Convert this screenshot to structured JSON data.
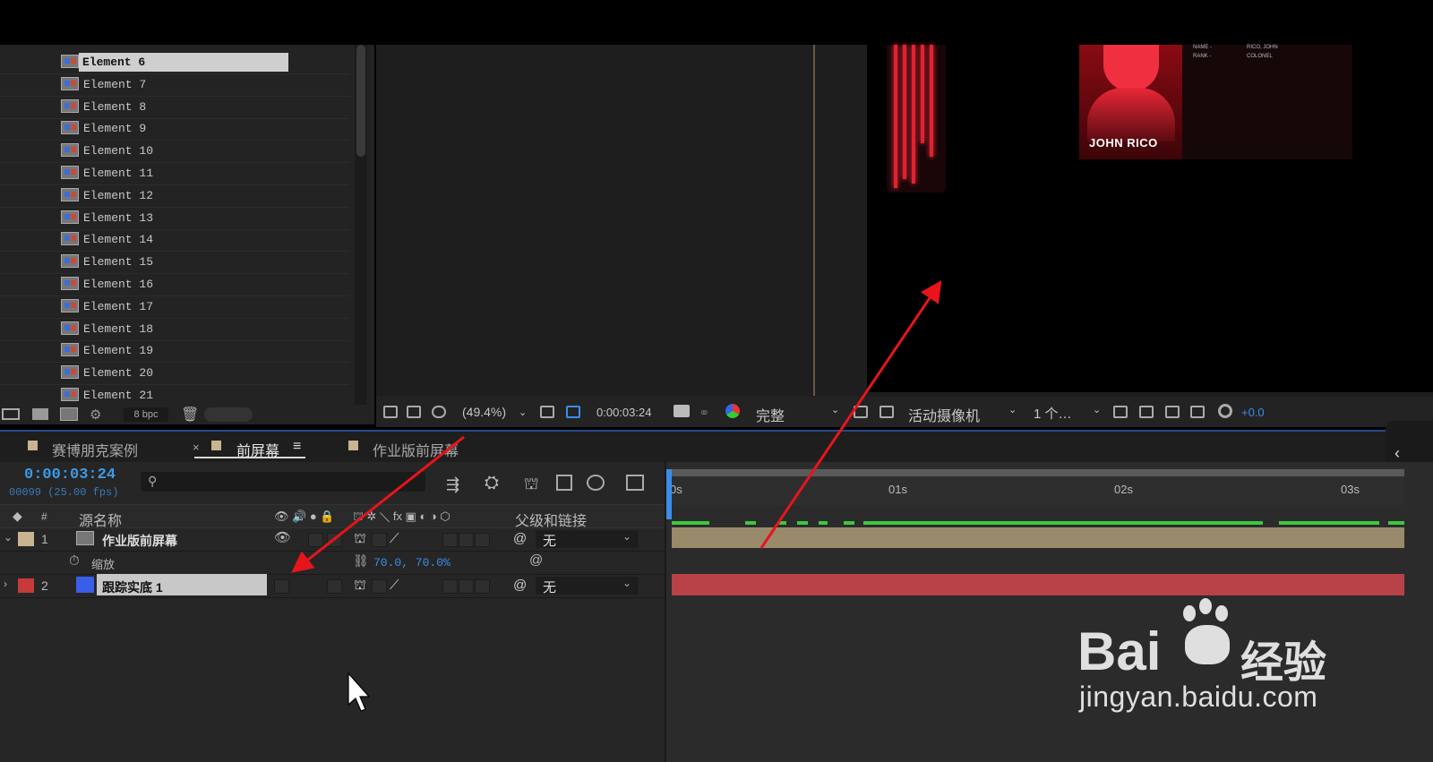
{
  "project": {
    "items": [
      {
        "label": "Element 6",
        "selected": true
      },
      {
        "label": "Element 7"
      },
      {
        "label": "Element 8"
      },
      {
        "label": "Element 9"
      },
      {
        "label": "Element 10"
      },
      {
        "label": "Element 11"
      },
      {
        "label": "Element 12"
      },
      {
        "label": "Element 13"
      },
      {
        "label": "Element 14"
      },
      {
        "label": "Element 15"
      },
      {
        "label": "Element 16"
      },
      {
        "label": "Element 17"
      },
      {
        "label": "Element 18"
      },
      {
        "label": "Element 19"
      },
      {
        "label": "Element 20"
      },
      {
        "label": "Element 21"
      }
    ],
    "bpc_label": "8 bpc"
  },
  "preview": {
    "card_name": "JOHN RICO",
    "card_field_1": "NAME -",
    "card_value_1": "RICO, JOHN",
    "card_field_2": "RANK -",
    "card_value_2": "COLONEL"
  },
  "viewer_toolbar": {
    "zoom": "(49.4%)",
    "timecode": "0:00:03:24",
    "resolution": "完整",
    "camera": "活动摄像机",
    "views": "1 个…",
    "exposure": "+0.0"
  },
  "tabs": [
    {
      "label": "赛博朋克案例",
      "active": false
    },
    {
      "label": "前屏幕",
      "active": true
    },
    {
      "label": "作业版前屏幕",
      "active": false
    }
  ],
  "timeline": {
    "timecode": "0:00:03:24",
    "frames": "00099 (25.00 fps)",
    "search_placeholder": "",
    "headers": {
      "num": "#",
      "source": "源名称",
      "parent": "父级和链接"
    },
    "layers": [
      {
        "num": "1",
        "name": "作业版前屏幕",
        "parent": "无",
        "label_color": "#c8b490"
      },
      {
        "num": "2",
        "name": "跟踪实底 1",
        "parent": "无",
        "label_color": "#c83a3a"
      }
    ],
    "property": {
      "name": "缩放",
      "value": "70.0, 70.0%"
    },
    "ruler": [
      "0s",
      "01s",
      "02s",
      "03s"
    ]
  },
  "watermark": {
    "brand": "Bai",
    "brand2": "经验",
    "url": "jingyan.baidu.com"
  },
  "colors": {
    "accent": "#3a9be8",
    "cache": "#3cc840",
    "arrow": "#e8141c"
  }
}
